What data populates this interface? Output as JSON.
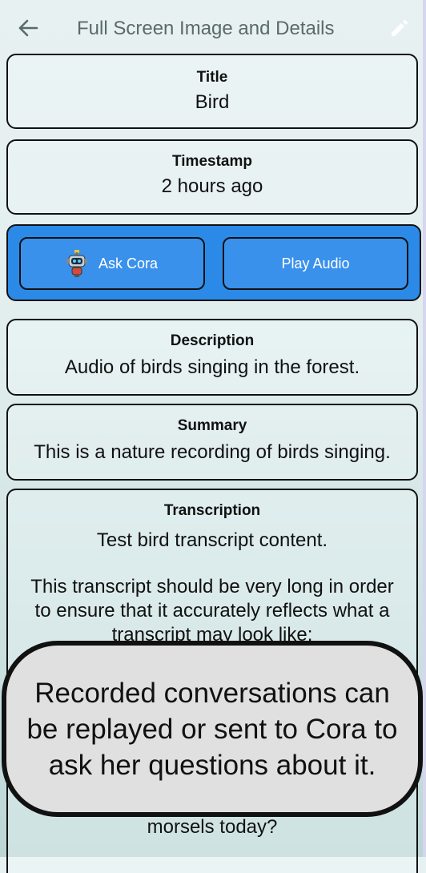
{
  "header": {
    "title": "Full Screen Image and Details",
    "back_icon": "arrow-left-icon",
    "edit_icon": "pencil-icon"
  },
  "title_card": {
    "label": "Title",
    "value": "Bird"
  },
  "timestamp_card": {
    "label": "Timestamp",
    "value": "2 hours ago"
  },
  "actions": {
    "ask_cora_label": "Ask Cora",
    "ask_cora_icon": "robot-icon",
    "play_audio_label": "Play Audio",
    "bar_color": "#2b8ae8"
  },
  "description_card": {
    "label": "Description",
    "value": "Audio of birds singing in the forest."
  },
  "summary_card": {
    "label": "Summary",
    "value": "This is a nature recording of birds singing."
  },
  "transcription_card": {
    "label": "Transcription",
    "first_line": "Test bird transcript content.",
    "paragraph": "This transcript should be very long in order to ensure that it accurately reflects what a transcript may look like:",
    "tail": "morsels today?"
  },
  "callout": {
    "text": "Recorded conversations can be replayed or sent to Cora to ask her questions about it."
  }
}
